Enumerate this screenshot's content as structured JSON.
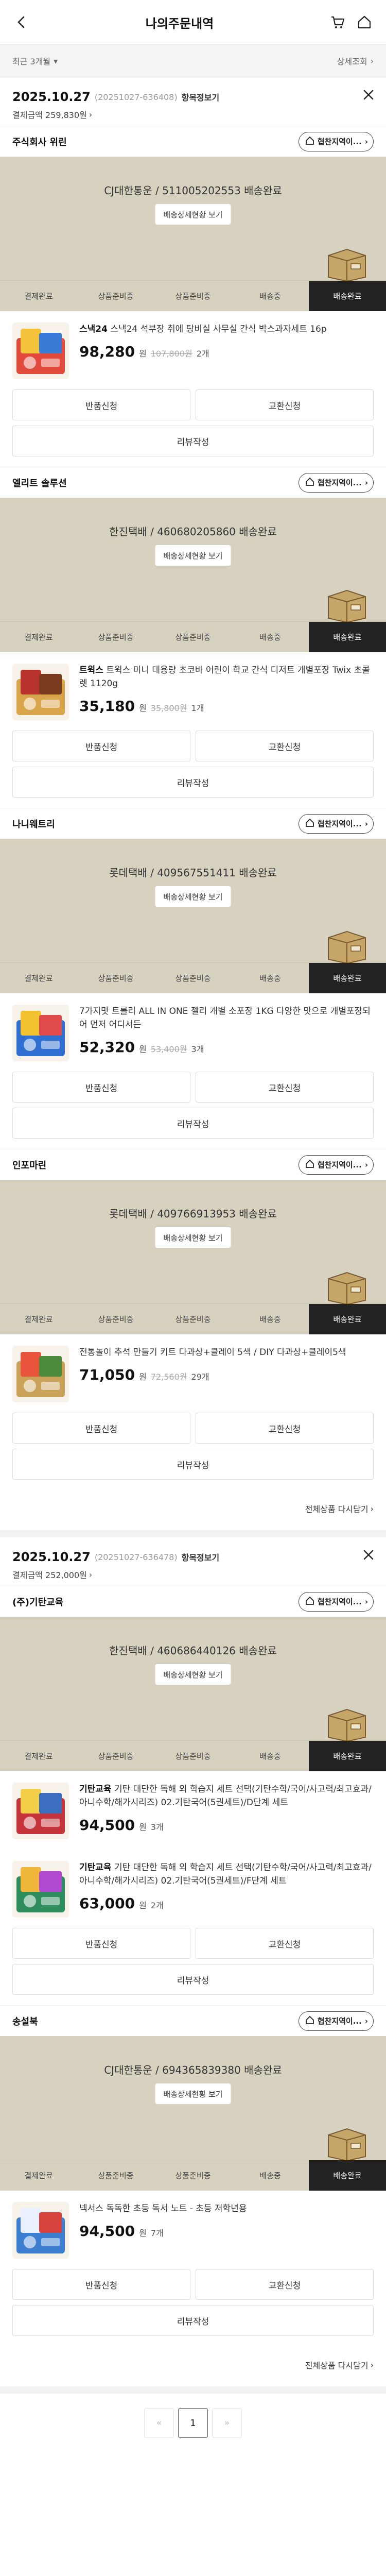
{
  "header": {
    "title": "나의주문내역"
  },
  "filter": {
    "period": "최근 3개월",
    "detail_search": "상세조회"
  },
  "orders": [
    {
      "date": "2025.10.27",
      "order_no": "(20251027-636408)",
      "detail_link": "항목정보기",
      "payment": "결제금액 259,830원",
      "sellers": [
        {
          "name": "주식회사 위린",
          "contact": "협찬지역이...",
          "courier": "CJ대한통운 / 511005202553 배송완료",
          "track_btn": "배송상세현황 보기",
          "products": [
            {
              "brand": "스낵24",
              "name": " 스낵24 석부장 취에 탕비실 사무실 간식 박스과자세트 16p",
              "price": "98,280",
              "unit": "원",
              "orig": "107,800원",
              "qty": "2개"
            }
          ]
        },
        {
          "name": "엘리트 솔루션",
          "contact": "협찬지역이...",
          "courier": "한진택배 / 460680205860 배송완료",
          "track_btn": "배송상세현황 보기",
          "products": [
            {
              "brand": "트윅스",
              "name": " 트윅스 미니 대용량 초코바 어린이 학교 간식 디저트 개별포장 Twix 초콜렛 1120g",
              "price": "35,180",
              "unit": "원",
              "orig": "35,800원",
              "qty": "1개"
            }
          ]
        },
        {
          "name": "나니웨트리",
          "contact": "협찬지역이...",
          "courier": "롯데택배 / 409567551411 배송완료",
          "track_btn": "배송상세현황 보기",
          "products": [
            {
              "brand": "",
              "name": "7가지맛 트롤리 ALL IN ONE 젤리 개별 소포장 1KG 다양한 맛으로 개별포장되어 먼저 어디서든",
              "price": "52,320",
              "unit": "원",
              "orig": "53,400원",
              "qty": "3개"
            }
          ]
        },
        {
          "name": "인포마린",
          "contact": "협찬지역이...",
          "courier": "롯데택배 / 409766913953 배송완료",
          "track_btn": "배송상세현황 보기",
          "products": [
            {
              "brand": "",
              "name": "전통놀이 추석 만들기 키트 다과상+클레이 5색 / DIY 다과상+클레이5색",
              "price": "71,050",
              "unit": "원",
              "orig": "72,560원",
              "qty": "29개"
            }
          ]
        }
      ],
      "more_link": "전체상품 다시담기"
    },
    {
      "date": "2025.10.27",
      "order_no": "(20251027-636478)",
      "detail_link": "항목정보기",
      "payment": "결제금액 252,000원",
      "sellers": [
        {
          "name": "(주)기탄교육",
          "contact": "협찬지역이...",
          "courier": "한진택배 / 460686440126 배송완료",
          "track_btn": "배송상세현황 보기",
          "products": [
            {
              "brand": "기탄교육",
              "name": " 기탄 대단한 독해 외 학습지 세트 선택(기탄수학/국어/사고력/최고효과/아니수학/해가시리즈) 02.기탄국어(5권세트)/D단계 세트",
              "price": "94,500",
              "unit": "원",
              "orig": "",
              "qty": "3개"
            },
            {
              "brand": "기탄교육",
              "name": " 기탄 대단한 독해 외 학습지 세트 선택(기탄수학/국어/사고력/최고효과/아니수학/해가시리즈) 02.기탄국어(5권세트)/F단계 세트",
              "price": "63,000",
              "unit": "원",
              "orig": "",
              "qty": "2개"
            }
          ]
        },
        {
          "name": "송설북",
          "contact": "협찬지역이...",
          "courier": "CJ대한통운 / 694365839380 배송완료",
          "track_btn": "배송상세현황 보기",
          "products": [
            {
              "brand": "",
              "name": "넥서스 독독한 초등 독서 노트 - 초등 저학년용",
              "price": "94,500",
              "unit": "원",
              "orig": "",
              "qty": "7개"
            }
          ]
        }
      ],
      "more_link": "전체상품 다시담기"
    }
  ],
  "steps": [
    "결제완료",
    "상품준비중",
    "상품준비중",
    "배송중",
    "배송완료"
  ],
  "buttons": {
    "return": "반품신청",
    "exchange": "교환신청",
    "review": "리뷰작성"
  },
  "pagination": {
    "current": "1"
  }
}
